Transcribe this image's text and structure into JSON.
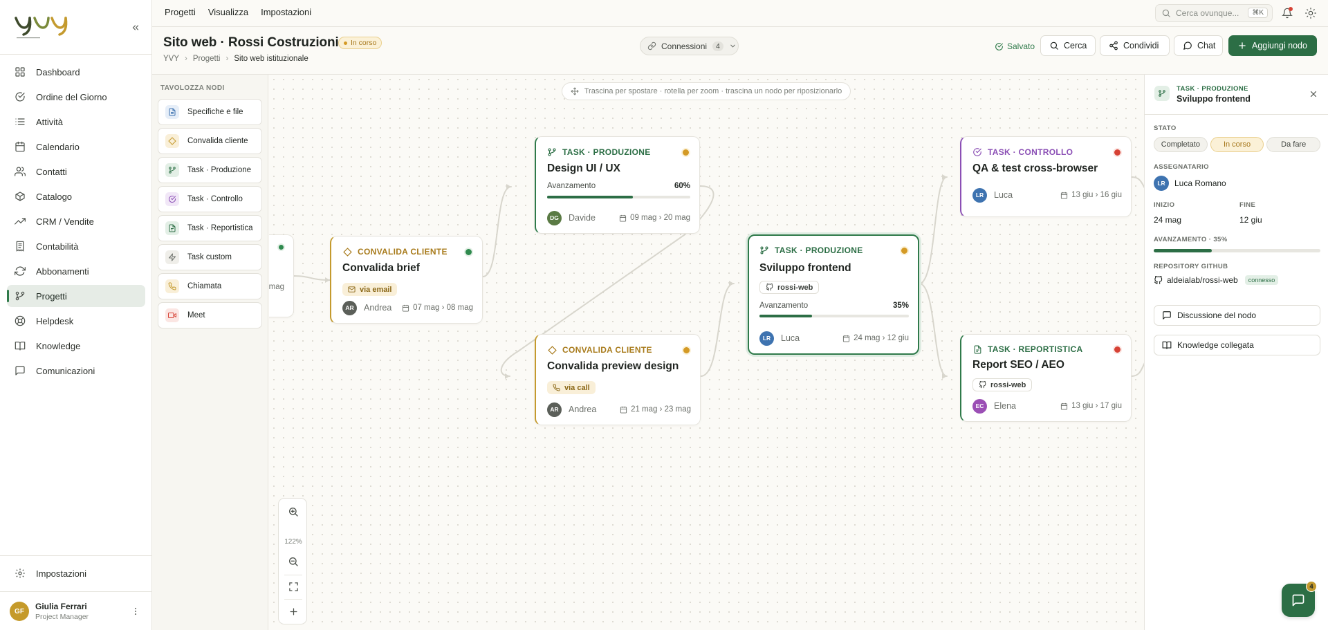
{
  "app": {
    "logo_text": "yvy",
    "logo_tagline": "the best of tech"
  },
  "sidebar": {
    "items": [
      {
        "label": "Dashboard",
        "icon": "grid-icon"
      },
      {
        "label": "Ordine del Giorno",
        "icon": "check-circle-icon"
      },
      {
        "label": "Attività",
        "icon": "list-icon"
      },
      {
        "label": "Calendario",
        "icon": "calendar-icon"
      },
      {
        "label": "Contatti",
        "icon": "users-icon"
      },
      {
        "label": "Catalogo",
        "icon": "box-icon"
      },
      {
        "label": "CRM / Vendite",
        "icon": "trending-up-icon"
      },
      {
        "label": "Contabilità",
        "icon": "receipt-icon"
      },
      {
        "label": "Abbonamenti",
        "icon": "refresh-icon"
      },
      {
        "label": "Progetti",
        "icon": "git-branch-icon",
        "active": true
      },
      {
        "label": "Helpdesk",
        "icon": "lifebuoy-icon"
      },
      {
        "label": "Knowledge",
        "icon": "book-icon"
      },
      {
        "label": "Comunicazioni",
        "icon": "message-square-icon"
      }
    ],
    "settings_label": "Impostazioni",
    "user": {
      "initials": "GF",
      "name": "Giulia Ferrari",
      "role": "Project Manager"
    }
  },
  "topmenu": {
    "items": [
      "Progetti",
      "Visualizza",
      "Impostazioni"
    ]
  },
  "search": {
    "placeholder": "Cerca ovunque...",
    "shortcut": "⌘K"
  },
  "header": {
    "title": "Sito web · Rossi Costruzioni",
    "status": "In corso",
    "breadcrumb": [
      "YVY",
      "Progetti",
      "Sito web istituzionale"
    ],
    "connections_label": "Connessioni",
    "connections_count": "4",
    "saved_label": "Salvato",
    "buttons": {
      "search": "Cerca",
      "share": "Condividi",
      "chat": "Chat",
      "add_node": "Aggiungi nodo"
    }
  },
  "palette": {
    "title": "TAVOLOZZA NODI",
    "items": [
      {
        "label": "Specifiche e file",
        "icon": "file-icon",
        "color": "#3e73b0"
      },
      {
        "label": "Convalida cliente",
        "icon": "diamond-icon",
        "color": "#c49a2e"
      },
      {
        "label": "Task · Produzione",
        "icon": "git-branch-icon",
        "color": "#2c6e45"
      },
      {
        "label": "Task · Controllo",
        "icon": "check-circle-icon",
        "color": "#8b4fb5"
      },
      {
        "label": "Task · Reportistica",
        "icon": "file-text-icon",
        "color": "#2c6e45"
      },
      {
        "label": "Task custom",
        "icon": "zap-icon",
        "color": "#6b6f69"
      },
      {
        "label": "Chiamata",
        "icon": "phone-icon",
        "color": "#c49a2e"
      },
      {
        "label": "Meet",
        "icon": "video-icon",
        "color": "#d64235"
      }
    ]
  },
  "canvas": {
    "hint": "Trascina per spostare · rotella per zoom · trascina un nodo per riposizionarlo",
    "zoom_label": "122%",
    "partial_node_date": "mag",
    "nodes": {
      "convalida_brief": {
        "kind": "Convalida cliente",
        "title": "Convalida brief",
        "chip": "via email",
        "initials": "AR",
        "assignee": "Andrea",
        "dates": "07 mag › 08 mag",
        "status_color": "#2f8a4e"
      },
      "design_ui": {
        "kind": "Task · Produzione",
        "title": "Design UI / UX",
        "progress_label": "Avanzamento",
        "progress": "60%",
        "progress_value": 0.6,
        "initials": "DG",
        "assignee": "Davide",
        "dates": "09 mag › 20 mag",
        "status_color": "#d49a25"
      },
      "convalida_preview": {
        "kind": "Convalida cliente",
        "title": "Convalida preview design",
        "chip": "via call",
        "initials": "AR",
        "assignee": "Andrea",
        "dates": "21 mag › 23 mag",
        "status_color": "#d49a25"
      },
      "sviluppo_frontend": {
        "kind": "Task · Produzione",
        "title": "Sviluppo frontend",
        "chip": "rossi-web",
        "progress_label": "Avanzamento",
        "progress": "35%",
        "progress_value": 0.35,
        "initials": "LR",
        "assignee": "Luca",
        "dates": "24 mag › 12 giu",
        "status_color": "#d49a25"
      },
      "qa_test": {
        "kind": "Task · Controllo",
        "title": "QA & test cross-browser",
        "initials": "LR",
        "assignee": "Luca",
        "dates": "13 giu › 16 giu",
        "status_color": "#d64235"
      },
      "report_seo": {
        "kind": "Task · Reportistica",
        "title": "Report SEO / AEO",
        "chip": "rossi-web",
        "initials": "EC",
        "assignee": "Elena",
        "dates": "13 giu › 17 giu",
        "status_color": "#d64235"
      }
    }
  },
  "panel": {
    "kind": "Task · Produzione",
    "title": "Sviluppo frontend",
    "state_label": "STATO",
    "states": [
      "Completato",
      "In corso",
      "Da fare"
    ],
    "selected_state": "In corso",
    "assignee_label": "ASSEGNATARIO",
    "assignee_initials": "LR",
    "assignee": "Luca Romano",
    "start_label": "INIZIO",
    "start": "24 mag",
    "end_label": "FINE",
    "end": "12 giu",
    "progress_label": "AVANZAMENTO · 35%",
    "progress_value": 0.35,
    "repo_label": "REPOSITORY GITHUB",
    "repo": "aldeialab/rossi-web",
    "repo_status": "connesso",
    "btn_discussion": "Discussione del nodo",
    "btn_knowledge": "Knowledge collegata"
  },
  "chat_fab": {
    "badge": "4"
  },
  "colors": {
    "accent": "#2c6e45",
    "gold": "#c49a2e",
    "purple": "#8b4fb5",
    "red": "#d64235",
    "blue": "#3e73b0"
  }
}
